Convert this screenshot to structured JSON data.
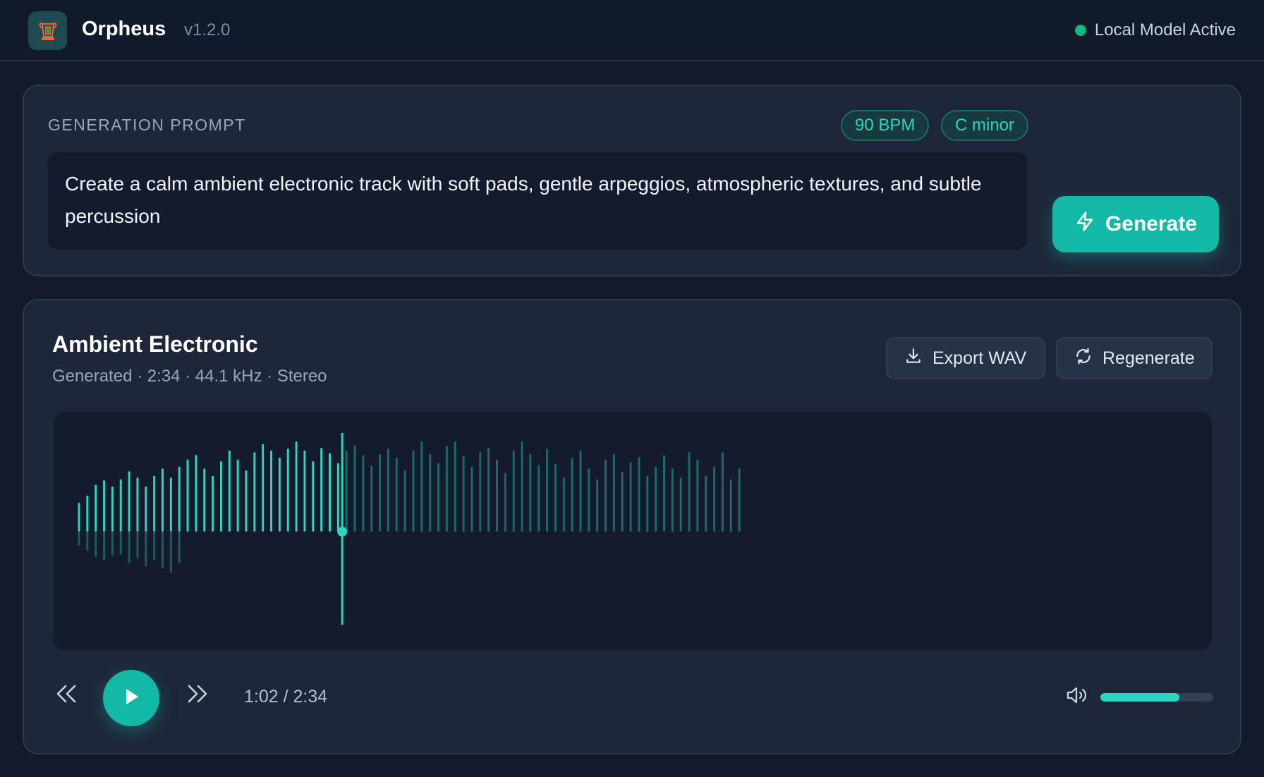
{
  "app": {
    "title": "Orpheus",
    "version": "v1.2.0",
    "status": "Local Model Active",
    "status_color": "#10b981",
    "accent": "#14b8a6",
    "logo_icon": "lyre-logo-icon"
  },
  "prompt": {
    "label": "GENERATION PROMPT",
    "tags": [
      "90 BPM",
      "C minor"
    ],
    "text": "Create a calm ambient electronic track with soft pads, gentle arpeggios, atmospheric textures, and subtle percussion",
    "generate_label": "Generate",
    "generate_icon": "lightning-icon"
  },
  "track": {
    "title": "Ambient Electronic",
    "meta": "Generated · 2:34 · 44.1 kHz · Stereo",
    "export_label": "Export WAV",
    "export_icon": "download-icon",
    "regenerate_label": "Regenerate",
    "regenerate_icon": "refresh-icon"
  },
  "player": {
    "time": "1:02 / 2:34",
    "progress": 0.4,
    "volume": 0.7,
    "icons": [
      "rewind-icon",
      "play-icon",
      "forward-icon",
      "volume-icon"
    ]
  },
  "waveform": {
    "bars": 80,
    "played_color": "#2dd4bf",
    "unplayed_color": "#1a6b66",
    "upper": [
      0.32,
      0.4,
      0.52,
      0.57,
      0.5,
      0.58,
      0.67,
      0.6,
      0.5,
      0.62,
      0.7,
      0.6,
      0.72,
      0.8,
      0.85,
      0.7,
      0.62,
      0.78,
      0.9,
      0.8,
      0.68,
      0.88,
      0.97,
      0.9,
      0.82,
      0.92,
      1.0,
      0.9,
      0.78,
      0.93,
      0.87,
      0.76,
      0.9,
      0.96,
      0.85,
      0.73,
      0.86,
      0.92,
      0.82,
      0.68,
      0.9,
      1.0,
      0.86,
      0.76,
      0.95,
      1.0,
      0.84,
      0.72,
      0.88,
      0.93,
      0.8,
      0.65,
      0.9,
      1.0,
      0.86,
      0.74,
      0.92,
      0.75,
      0.6,
      0.82,
      0.9,
      0.7,
      0.58,
      0.8,
      0.86,
      0.66,
      0.77,
      0.83,
      0.62,
      0.72,
      0.85,
      0.7,
      0.6,
      0.88,
      0.8,
      0.62,
      0.72,
      0.88,
      0.58,
      0.7
    ],
    "lower": [
      0.22,
      0.3,
      0.4,
      0.45,
      0.38,
      0.36,
      0.5,
      0.42,
      0.55,
      0.45,
      0.58,
      0.65,
      0.5
    ]
  }
}
